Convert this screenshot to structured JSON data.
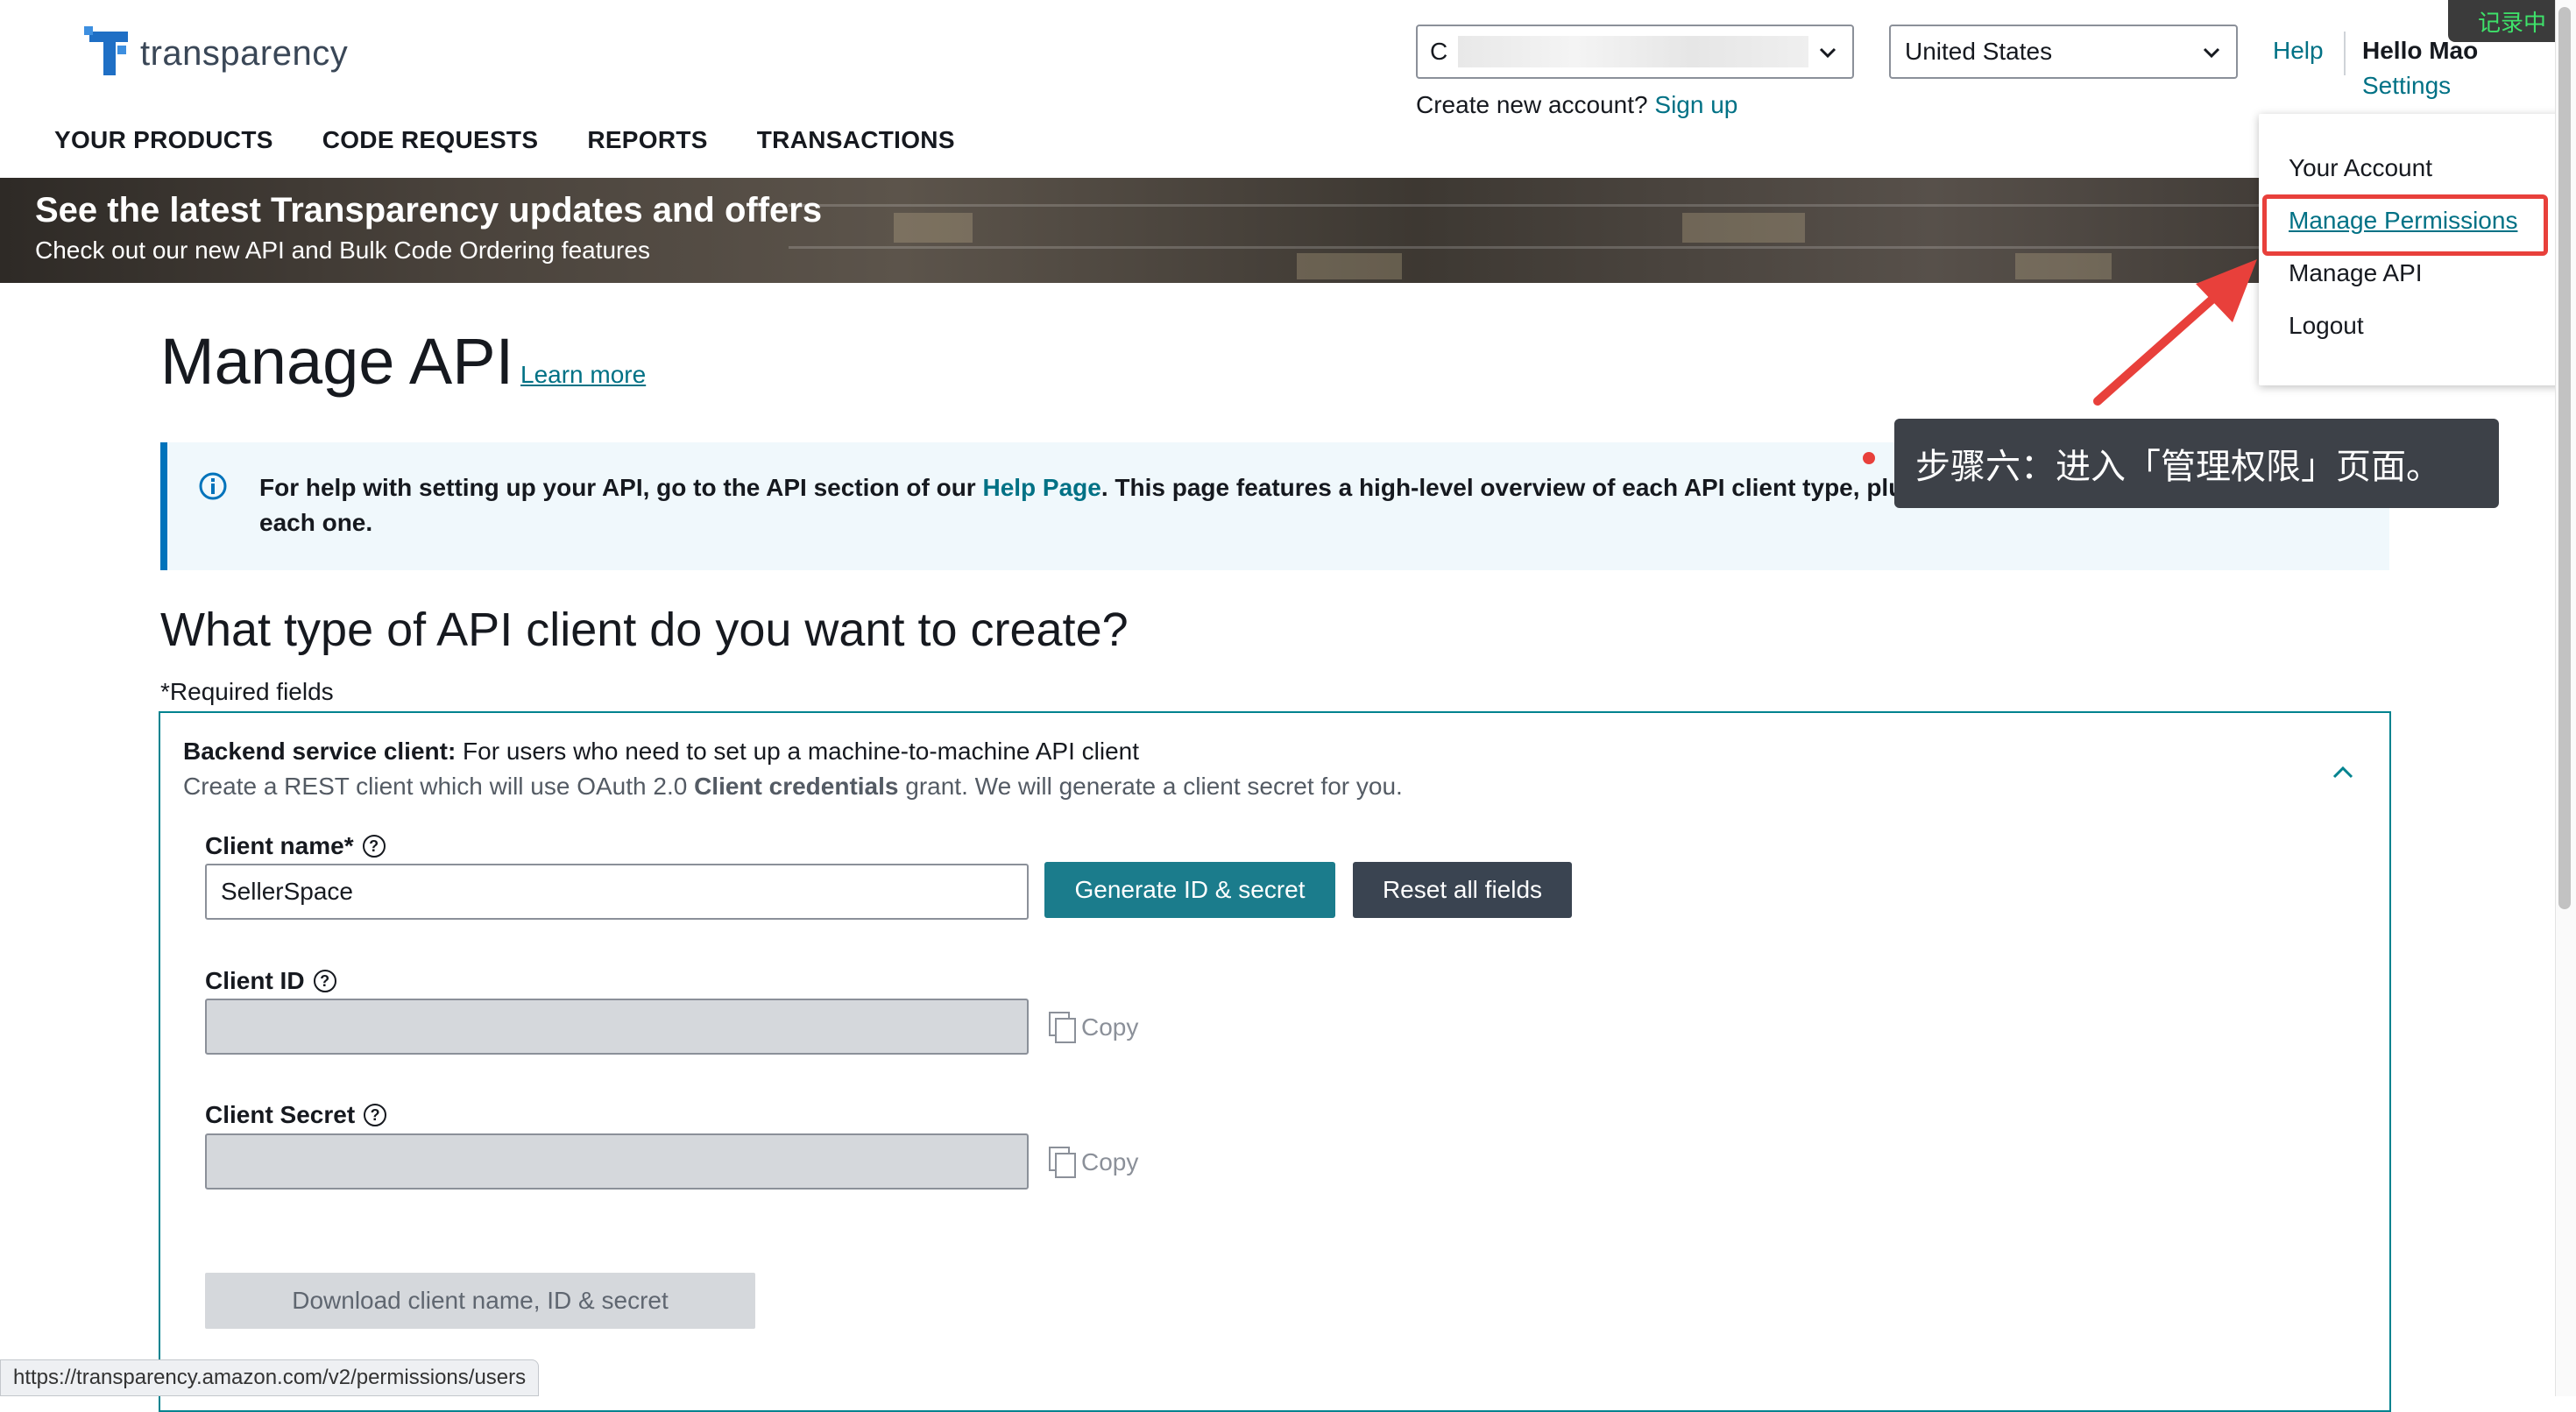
{
  "header": {
    "logo_text": "transparency",
    "account_select": {
      "value": "C"
    },
    "country_select": {
      "value": "United States"
    },
    "create_account": {
      "prompt": "Create new account?",
      "link": "Sign up"
    },
    "help": "Help",
    "greeting": "Hello Mao",
    "settings": "Settings",
    "recording_badge": "记录中"
  },
  "nav": {
    "items": [
      "YOUR PRODUCTS",
      "CODE REQUESTS",
      "REPORTS",
      "TRANSACTIONS"
    ]
  },
  "banner": {
    "title": "See the latest Transparency updates and offers",
    "subtitle": "Check out our new API and Bulk Code Ordering features"
  },
  "main": {
    "title": "Manage API",
    "learn_more": "Learn more",
    "info": {
      "text_before": "For help with setting up your API, go to the API section of our ",
      "link": "Help Page",
      "text_after": ". This page features a high-level overview of each API client type, plus in-depth technical documentation for each one."
    },
    "question": "What type of API client do you want to create?",
    "required_note": "*Required fields",
    "backend": {
      "title_bold": "Backend service client:",
      "title_rest": " For users who need to set up a machine-to-machine API client",
      "desc_before": "Create a REST client which will use OAuth 2.0 ",
      "desc_bold": "Client credentials",
      "desc_after": " grant. We will generate a client secret for you."
    },
    "form": {
      "client_name_label": "Client name*",
      "client_name_value": "SellerSpace",
      "generate_button": "Generate ID & secret",
      "reset_button": "Reset all fields",
      "client_id_label": "Client ID",
      "client_secret_label": "Client Secret",
      "copy_label": "Copy",
      "download_button": "Download client name, ID & secret"
    }
  },
  "dropdown": {
    "items": [
      "Your Account",
      "Manage Permissions",
      "Manage API",
      "Logout"
    ],
    "highlighted": "Manage Permissions"
  },
  "annotation": {
    "text": "步骤六：进入「管理权限」页面。",
    "color": "#e8403b"
  },
  "status_url": "https://transparency.amazon.com/v2/permissions/users",
  "colors": {
    "link": "#007185",
    "primary_button": "#1b7c8c",
    "dark_button": "#3a4451",
    "info_border": "#0073bb",
    "highlight": "#e8403b"
  }
}
